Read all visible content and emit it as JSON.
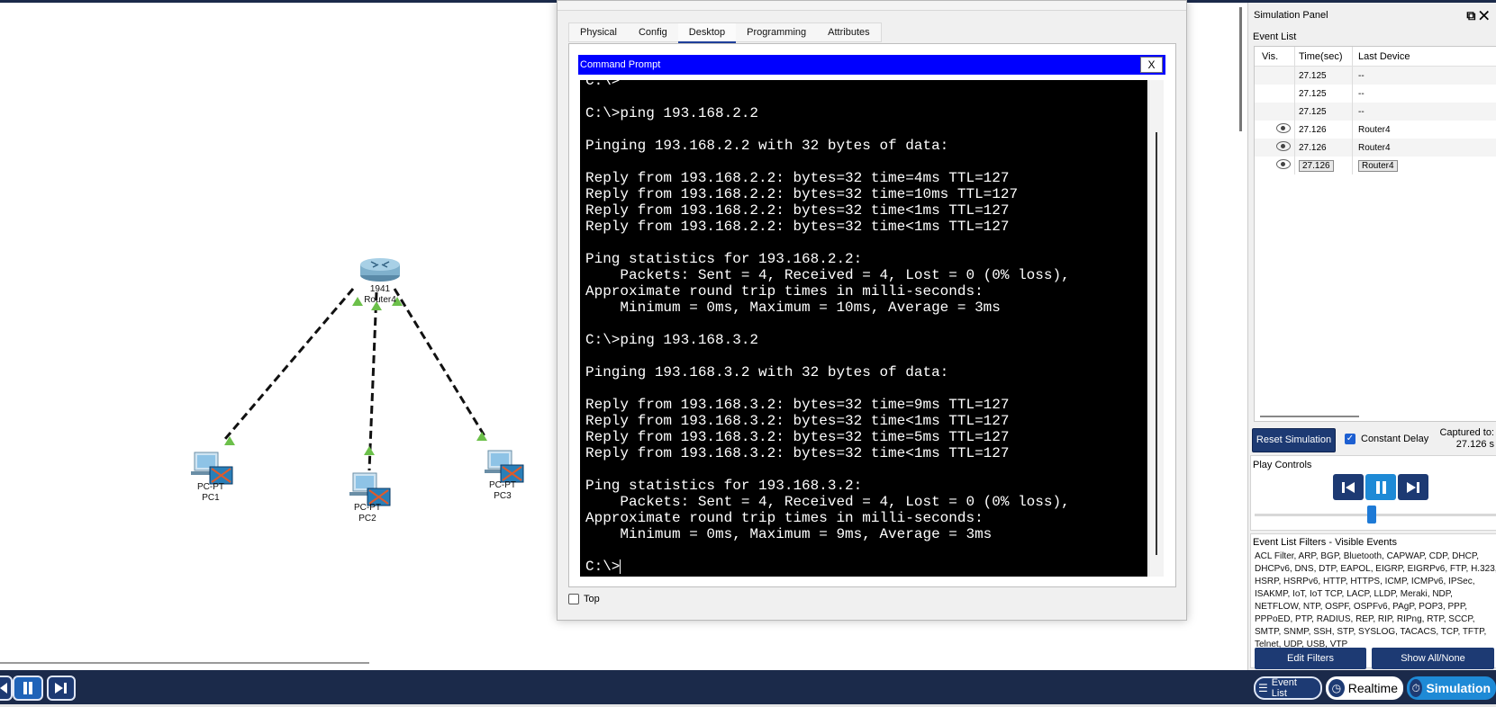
{
  "workspace": {
    "router": {
      "model": "1941",
      "name": "Router4"
    },
    "pcs": [
      {
        "model": "PC-PT",
        "name": "PC1"
      },
      {
        "model": "PC-PT",
        "name": "PC2"
      },
      {
        "model": "PC-PT",
        "name": "PC3"
      }
    ]
  },
  "dialog": {
    "tabs": [
      "Physical",
      "Config",
      "Desktop",
      "Programming",
      "Attributes"
    ],
    "active_tab": "Desktop",
    "cmd_title": "Command Prompt",
    "cmd_close": "X",
    "terminal_lines": [
      "C:\\>",
      "",
      "C:\\>ping 193.168.2.2",
      "",
      "Pinging 193.168.2.2 with 32 bytes of data:",
      "",
      "Reply from 193.168.2.2: bytes=32 time=4ms TTL=127",
      "Reply from 193.168.2.2: bytes=32 time=10ms TTL=127",
      "Reply from 193.168.2.2: bytes=32 time<1ms TTL=127",
      "Reply from 193.168.2.2: bytes=32 time<1ms TTL=127",
      "",
      "Ping statistics for 193.168.2.2:",
      "    Packets: Sent = 4, Received = 4, Lost = 0 (0% loss),",
      "Approximate round trip times in milli-seconds:",
      "    Minimum = 0ms, Maximum = 10ms, Average = 3ms",
      "",
      "C:\\>ping 193.168.3.2",
      "",
      "Pinging 193.168.3.2 with 32 bytes of data:",
      "",
      "Reply from 193.168.3.2: bytes=32 time=9ms TTL=127",
      "Reply from 193.168.3.2: bytes=32 time<1ms TTL=127",
      "Reply from 193.168.3.2: bytes=32 time=5ms TTL=127",
      "Reply from 193.168.3.2: bytes=32 time<1ms TTL=127",
      "",
      "Ping statistics for 193.168.3.2:",
      "    Packets: Sent = 4, Received = 4, Lost = 0 (0% loss),",
      "Approximate round trip times in milli-seconds:",
      "    Minimum = 0ms, Maximum = 9ms, Average = 3ms",
      "",
      "C:\\>"
    ],
    "top_checkbox_label": "Top"
  },
  "sim_panel": {
    "title": "Simulation Panel",
    "event_list_label": "Event List",
    "columns": {
      "vis": "Vis.",
      "time": "Time(sec)",
      "device": "Last Device"
    },
    "events": [
      {
        "eye": false,
        "time": "27.125",
        "device": "--"
      },
      {
        "eye": false,
        "time": "27.125",
        "device": "--"
      },
      {
        "eye": false,
        "time": "27.125",
        "device": "--"
      },
      {
        "eye": true,
        "time": "27.126",
        "device": "Router4"
      },
      {
        "eye": true,
        "time": "27.126",
        "device": "Router4"
      },
      {
        "eye": true,
        "time": "27.126",
        "device": "Router4",
        "selected": true
      }
    ],
    "reset_label": "Reset Simulation",
    "constant_delay_label": "Constant Delay",
    "captured_label": "Captured to:",
    "captured_value": "27.126 s",
    "play_controls_label": "Play Controls",
    "filters_label": "Event List Filters - Visible Events",
    "filters_text": "ACL Filter, ARP, BGP, Bluetooth, CAPWAP, CDP, DHCP, DHCPv6, DNS, DTP, EAPOL, EIGRP, EIGRPv6, FTP, H.323, HSRP, HSRPv6, HTTP, HTTPS, ICMP, ICMPv6, IPSec, ISAKMP, IoT, IoT TCP, LACP, LLDP, Meraki, NDP, NETFLOW, NTP, OSPF, OSPFv6, PAgP, POP3, PPP, PPPoED, PTP, RADIUS, REP, RIP, RIPng, RTP, SCCP, SMTP, SNMP, SSH, STP, SYSLOG, TACACS, TCP, TFTP, Telnet, UDP, USB, VTP",
    "edit_filters_label": "Edit Filters",
    "show_all_label": "Show All/None"
  },
  "bottom_bar": {
    "event_list_label": "Event List",
    "realtime_label": "Realtime",
    "simulation_label": "Simulation"
  },
  "colors": {
    "navy": "#1d3a73",
    "cmd_title_blue": "#0000ff",
    "link_green": "#6cc04a",
    "accent_blue": "#1e8ad6"
  }
}
